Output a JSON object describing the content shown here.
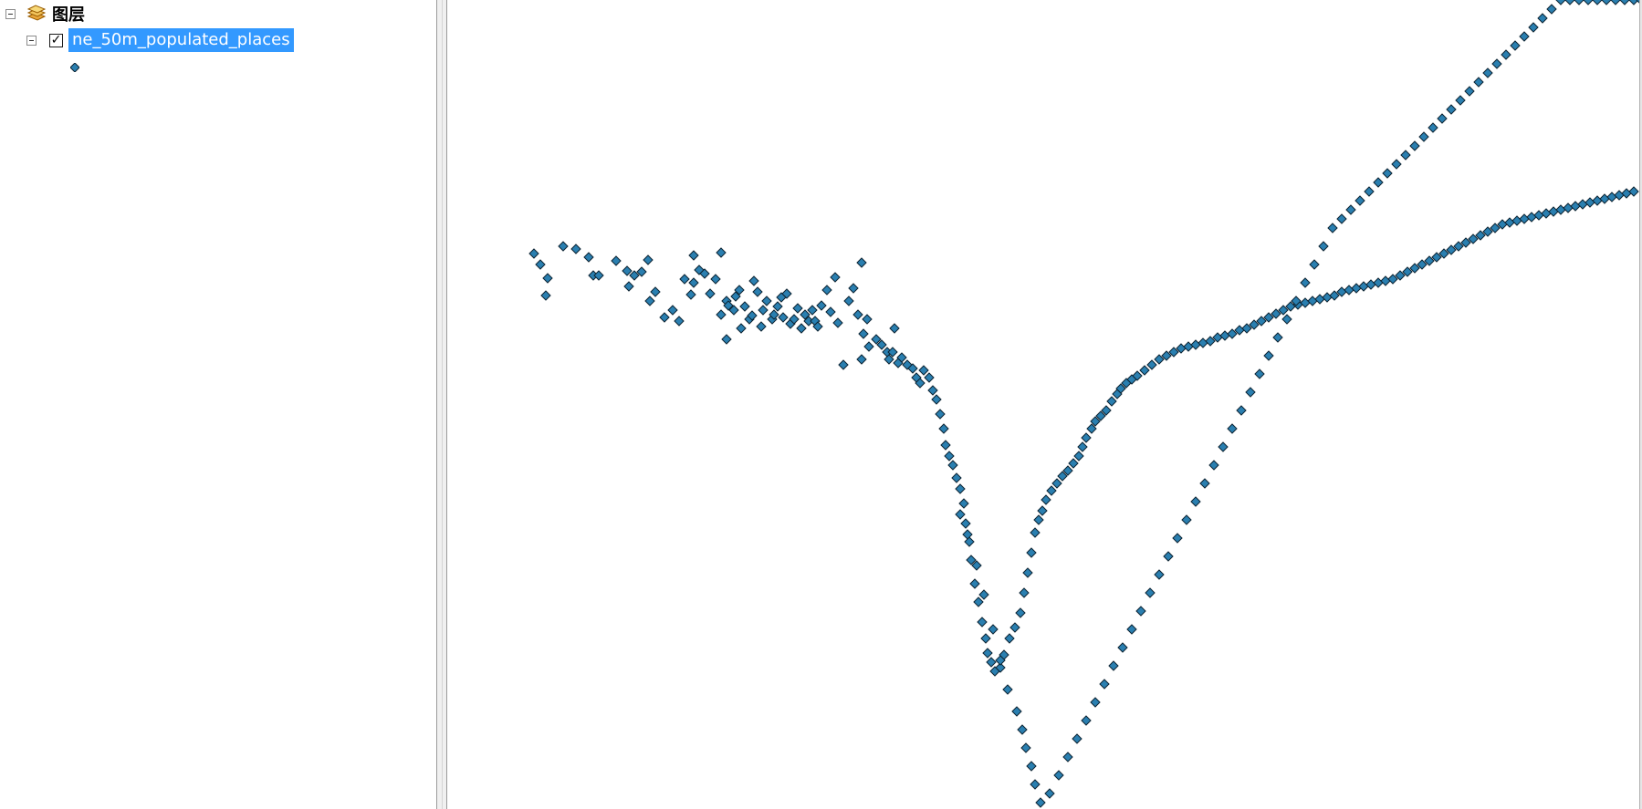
{
  "toc": {
    "group": {
      "label": "图层",
      "icon": "layers-icon"
    },
    "layer": {
      "label": "ne_50m_populated_places",
      "checked": "✓",
      "selected_color": "#3399ff"
    },
    "legend": {
      "symbol": "diamond-point-symbol"
    }
  },
  "map": {
    "symbol": {
      "fill": "#2a7fb0",
      "stroke": "#0d2433",
      "shape": "diamond"
    },
    "points": [
      [
        585,
        278
      ],
      [
        592,
        290
      ],
      [
        600,
        305
      ],
      [
        598,
        324
      ],
      [
        617,
        270
      ],
      [
        631,
        273
      ],
      [
        645,
        282
      ],
      [
        650,
        302
      ],
      [
        656,
        302
      ],
      [
        675,
        286
      ],
      [
        687,
        297
      ],
      [
        689,
        314
      ],
      [
        695,
        302
      ],
      [
        703,
        298
      ],
      [
        710,
        285
      ],
      [
        712,
        330
      ],
      [
        718,
        320
      ],
      [
        728,
        348
      ],
      [
        737,
        340
      ],
      [
        744,
        352
      ],
      [
        750,
        306
      ],
      [
        757,
        323
      ],
      [
        760,
        280
      ],
      [
        760,
        310
      ],
      [
        766,
        296
      ],
      [
        772,
        300
      ],
      [
        778,
        322
      ],
      [
        784,
        306
      ],
      [
        790,
        277
      ],
      [
        790,
        345
      ],
      [
        796,
        330
      ],
      [
        796,
        372
      ],
      [
        798,
        335
      ],
      [
        804,
        340
      ],
      [
        806,
        325
      ],
      [
        810,
        318
      ],
      [
        812,
        360
      ],
      [
        816,
        336
      ],
      [
        821,
        350
      ],
      [
        824,
        346
      ],
      [
        826,
        308
      ],
      [
        830,
        320
      ],
      [
        834,
        358
      ],
      [
        836,
        340
      ],
      [
        840,
        330
      ],
      [
        846,
        350
      ],
      [
        848,
        345
      ],
      [
        852,
        336
      ],
      [
        856,
        326
      ],
      [
        858,
        348
      ],
      [
        862,
        322
      ],
      [
        866,
        355
      ],
      [
        870,
        350
      ],
      [
        874,
        338
      ],
      [
        878,
        360
      ],
      [
        882,
        345
      ],
      [
        886,
        352
      ],
      [
        890,
        340
      ],
      [
        893,
        352
      ],
      [
        896,
        358
      ],
      [
        900,
        335
      ],
      [
        906,
        318
      ],
      [
        910,
        342
      ],
      [
        915,
        304
      ],
      [
        918,
        354
      ],
      [
        924,
        400
      ],
      [
        930,
        330
      ],
      [
        935,
        316
      ],
      [
        940,
        345
      ],
      [
        944,
        288
      ],
      [
        944,
        394
      ],
      [
        946,
        366
      ],
      [
        950,
        350
      ],
      [
        952,
        380
      ],
      [
        960,
        372
      ],
      [
        966,
        378
      ],
      [
        972,
        386
      ],
      [
        974,
        394
      ],
      [
        978,
        386
      ],
      [
        980,
        360
      ],
      [
        984,
        398
      ],
      [
        988,
        392
      ],
      [
        994,
        400
      ],
      [
        1000,
        404
      ],
      [
        1004,
        414
      ],
      [
        1008,
        420
      ],
      [
        1012,
        406
      ],
      [
        1018,
        414
      ],
      [
        1022,
        428
      ],
      [
        1026,
        438
      ],
      [
        1030,
        454
      ],
      [
        1034,
        470
      ],
      [
        1036,
        488
      ],
      [
        1040,
        500
      ],
      [
        1044,
        510
      ],
      [
        1048,
        524
      ],
      [
        1052,
        536
      ],
      [
        1056,
        552
      ],
      [
        1058,
        574
      ],
      [
        1062,
        594
      ],
      [
        1064,
        614
      ],
      [
        1068,
        640
      ],
      [
        1072,
        660
      ],
      [
        1076,
        682
      ],
      [
        1080,
        700
      ],
      [
        1082,
        716
      ],
      [
        1086,
        726
      ],
      [
        1090,
        736
      ],
      [
        1096,
        732
      ],
      [
        1100,
        718
      ],
      [
        1106,
        700
      ],
      [
        1112,
        688
      ],
      [
        1118,
        672
      ],
      [
        1122,
        650
      ],
      [
        1126,
        628
      ],
      [
        1130,
        606
      ],
      [
        1134,
        584
      ],
      [
        1138,
        570
      ],
      [
        1142,
        560
      ],
      [
        1146,
        548
      ],
      [
        1152,
        538
      ],
      [
        1158,
        530
      ],
      [
        1164,
        522
      ],
      [
        1170,
        516
      ],
      [
        1176,
        508
      ],
      [
        1182,
        500
      ],
      [
        1186,
        490
      ],
      [
        1190,
        480
      ],
      [
        1196,
        470
      ],
      [
        1200,
        462
      ],
      [
        1206,
        456
      ],
      [
        1212,
        450
      ],
      [
        1218,
        440
      ],
      [
        1224,
        432
      ],
      [
        1228,
        426
      ],
      [
        1234,
        420
      ],
      [
        1240,
        416
      ],
      [
        1246,
        412
      ],
      [
        1254,
        406
      ],
      [
        1262,
        400
      ],
      [
        1270,
        394
      ],
      [
        1278,
        390
      ],
      [
        1286,
        386
      ],
      [
        1294,
        382
      ],
      [
        1302,
        380
      ],
      [
        1310,
        378
      ],
      [
        1318,
        376
      ],
      [
        1326,
        374
      ],
      [
        1334,
        370
      ],
      [
        1342,
        368
      ],
      [
        1350,
        366
      ],
      [
        1358,
        362
      ],
      [
        1366,
        360
      ],
      [
        1374,
        356
      ],
      [
        1382,
        352
      ],
      [
        1390,
        348
      ],
      [
        1398,
        344
      ],
      [
        1406,
        340
      ],
      [
        1414,
        336
      ],
      [
        1422,
        334
      ],
      [
        1430,
        332
      ],
      [
        1438,
        330
      ],
      [
        1446,
        328
      ],
      [
        1454,
        326
      ],
      [
        1462,
        324
      ],
      [
        1470,
        320
      ],
      [
        1478,
        318
      ],
      [
        1486,
        316
      ],
      [
        1494,
        314
      ],
      [
        1502,
        312
      ],
      [
        1510,
        310
      ],
      [
        1518,
        308
      ],
      [
        1526,
        306
      ],
      [
        1534,
        302
      ],
      [
        1542,
        298
      ],
      [
        1550,
        294
      ],
      [
        1558,
        290
      ],
      [
        1566,
        286
      ],
      [
        1574,
        282
      ],
      [
        1582,
        278
      ],
      [
        1590,
        274
      ],
      [
        1598,
        270
      ],
      [
        1606,
        266
      ],
      [
        1614,
        262
      ],
      [
        1622,
        258
      ],
      [
        1630,
        254
      ],
      [
        1638,
        250
      ],
      [
        1646,
        246
      ],
      [
        1654,
        244
      ],
      [
        1662,
        242
      ],
      [
        1670,
        240
      ],
      [
        1678,
        238
      ],
      [
        1686,
        236
      ],
      [
        1694,
        234
      ],
      [
        1702,
        232
      ],
      [
        1710,
        230
      ],
      [
        1718,
        228
      ],
      [
        1726,
        226
      ],
      [
        1734,
        224
      ],
      [
        1742,
        222
      ],
      [
        1750,
        220
      ],
      [
        1758,
        218
      ],
      [
        1766,
        216
      ],
      [
        1774,
        214
      ],
      [
        1782,
        212
      ],
      [
        1790,
        210
      ],
      [
        1052,
        564
      ],
      [
        1060,
        586
      ],
      [
        1070,
        620
      ],
      [
        1078,
        652
      ],
      [
        1088,
        690
      ],
      [
        1096,
        724
      ],
      [
        1104,
        756
      ],
      [
        1114,
        780
      ],
      [
        1120,
        800
      ],
      [
        1124,
        820
      ],
      [
        1130,
        840
      ],
      [
        1134,
        860
      ],
      [
        1140,
        880
      ],
      [
        1150,
        870
      ],
      [
        1160,
        850
      ],
      [
        1170,
        830
      ],
      [
        1180,
        810
      ],
      [
        1190,
        790
      ],
      [
        1200,
        770
      ],
      [
        1210,
        750
      ],
      [
        1220,
        730
      ],
      [
        1230,
        710
      ],
      [
        1240,
        690
      ],
      [
        1250,
        670
      ],
      [
        1260,
        650
      ],
      [
        1270,
        630
      ],
      [
        1280,
        610
      ],
      [
        1290,
        590
      ],
      [
        1300,
        570
      ],
      [
        1310,
        550
      ],
      [
        1320,
        530
      ],
      [
        1330,
        510
      ],
      [
        1340,
        490
      ],
      [
        1350,
        470
      ],
      [
        1360,
        450
      ],
      [
        1370,
        430
      ],
      [
        1380,
        410
      ],
      [
        1390,
        390
      ],
      [
        1400,
        370
      ],
      [
        1410,
        350
      ],
      [
        1420,
        330
      ],
      [
        1430,
        310
      ],
      [
        1440,
        290
      ],
      [
        1450,
        270
      ],
      [
        1460,
        250
      ],
      [
        1470,
        240
      ],
      [
        1480,
        230
      ],
      [
        1490,
        220
      ],
      [
        1500,
        210
      ],
      [
        1510,
        200
      ],
      [
        1520,
        190
      ],
      [
        1530,
        180
      ],
      [
        1540,
        170
      ],
      [
        1550,
        160
      ],
      [
        1560,
        150
      ],
      [
        1570,
        140
      ],
      [
        1580,
        130
      ],
      [
        1590,
        120
      ],
      [
        1600,
        110
      ],
      [
        1610,
        100
      ],
      [
        1620,
        90
      ],
      [
        1630,
        80
      ],
      [
        1640,
        70
      ],
      [
        1650,
        60
      ],
      [
        1660,
        50
      ],
      [
        1670,
        40
      ],
      [
        1680,
        30
      ],
      [
        1690,
        20
      ],
      [
        1700,
        10
      ],
      [
        1710,
        0
      ],
      [
        1720,
        0
      ],
      [
        1730,
        0
      ],
      [
        1740,
        0
      ],
      [
        1750,
        0
      ],
      [
        1760,
        0
      ],
      [
        1770,
        0
      ],
      [
        1780,
        0
      ],
      [
        1790,
        0
      ],
      [
        1798,
        0
      ]
    ]
  }
}
